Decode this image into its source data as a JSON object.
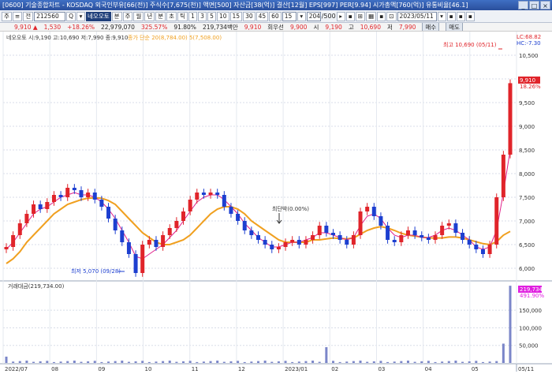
{
  "window": {
    "title": "[0600] 기술종합차트 - KOSDAQ 외국인부유[66(전)] 주식수[7,675(천)] 액면[500] 자산금[38(억)] 결산[12월] EPS[997] PER[9.94] 시가총액[760(억)] 유통비율[46.1]",
    "btn_min": "_",
    "btn_max": "□",
    "btn_close": "×"
  },
  "toolbar": {
    "item0": "주",
    "item1": "≡",
    "item2": "전",
    "code": "212560",
    "item4": "Q",
    "item5": "▾",
    "stock_name": "네오오토",
    "item7": "분",
    "item8": "주",
    "item9": "월",
    "item10": "년",
    "item11": "분",
    "item12": "초",
    "item13": "틱",
    "item14": "1",
    "item15": "3",
    "item16": "5",
    "item17": "10",
    "item18": "15",
    "item19": "30",
    "item20": "45",
    "item21": "60",
    "item22": "15",
    "item23": "▾",
    "count": "204",
    "count_total": "/500",
    "item26": "▸",
    "item27": "▪",
    "item28": "⊞",
    "item29": "▦",
    "item30": "▪",
    "item31": "⊡",
    "date": "2023/05/11",
    "item33": "▾",
    "item34": "▪",
    "item35": "▪",
    "item36": "▪"
  },
  "pricebar": {
    "price": "9,910 ▲",
    "change": "1,530",
    "change_pct": "+18.26%",
    "volume": "22,979,070",
    "volume_pct": "325.57%",
    "turnover": "91.80%",
    "amount": "219,734백만",
    "prev": "9,910",
    "bid": "9,900",
    "low_label": "시",
    "open": "9,190",
    "high_label": "고",
    "high": "10,690",
    "low2_label": "저",
    "low": "7,990",
    "sell_btn": "매수",
    "buy_btn": "매도",
    "label_rel": "회우선"
  },
  "legend": {
    "main": "네오오토 시:9,190 고:10,690 저:7,990 종:9,910",
    "ma": "종가 단순 20(8,784.00)  5(7,508.00)",
    "volume": "거래대금(219,734.00)",
    "lc": "LC:68.82",
    "hc": "HC:-7.30"
  },
  "annotations": {
    "max": "최고 10,690 (05/11)",
    "min": "최저 5,070 (09/28)",
    "mid": "최단박(0.00%)",
    "price_tag": "9,910",
    "price_tag_sub": "18.26%",
    "vol_tag": "219,734",
    "vol_tag_sub": "491.90%"
  },
  "colors": {
    "up": "#e0242a",
    "down": "#1d3fd0",
    "ma5": "#e0208a",
    "ma20": "#f0a020",
    "volume": "#7b86c9"
  },
  "chart_data": {
    "type": "line",
    "price_axis": {
      "ticks": [
        "10,500",
        "10,000",
        "9,500",
        "9,000",
        "8,500",
        "8,000",
        "7,500",
        "7,000",
        "6,500",
        "6,000"
      ]
    },
    "volume_axis": {
      "ticks": [
        "150,000",
        "100,000",
        "50,000"
      ]
    },
    "x_labels": [
      "2022/07",
      "08",
      "09",
      "10",
      "11",
      "12",
      "2023/01",
      "02",
      "03",
      "04",
      "05",
      "05/11"
    ],
    "series": [
      {
        "name": "종가",
        "values": [
          6450,
          6700,
          6950,
          7150,
          7350,
          7250,
          7400,
          7550,
          7500,
          7700,
          7650,
          7500,
          7600,
          7450,
          7300,
          7050,
          6800,
          6550,
          6300,
          5900,
          6500,
          6600,
          6450,
          6700,
          6850,
          7000,
          7200,
          7450,
          7600,
          7550,
          7600,
          7550,
          7300,
          7150,
          7000,
          6800,
          6700,
          6600,
          6500,
          6400,
          6450,
          6550,
          6600,
          6500,
          6600,
          6700,
          6900,
          6750,
          6700,
          6600,
          6500,
          6700,
          7200,
          7300,
          7100,
          6900,
          6600,
          6550,
          6700,
          6800,
          6700,
          6650,
          6600,
          6700,
          6900,
          6950,
          6750,
          6600,
          6500,
          6400,
          6300,
          6500,
          7500,
          8400,
          9910
        ]
      },
      {
        "name": "5",
        "values": [
          6400,
          6550,
          6750,
          6950,
          7150,
          7250,
          7300,
          7400,
          7500,
          7550,
          7600,
          7550,
          7550,
          7500,
          7400,
          7250,
          7050,
          6800,
          6550,
          6250,
          6200,
          6300,
          6400,
          6500,
          6650,
          6800,
          7000,
          7200,
          7400,
          7500,
          7550,
          7550,
          7450,
          7300,
          7150,
          6950,
          6800,
          6650,
          6550,
          6450,
          6450,
          6500,
          6550,
          6550,
          6600,
          6650,
          6750,
          6750,
          6700,
          6650,
          6600,
          6650,
          6900,
          7100,
          7150,
          7050,
          6850,
          6700,
          6650,
          6700,
          6700,
          6650,
          6650,
          6700,
          6800,
          6850,
          6800,
          6700,
          6600,
          6450,
          6400,
          6450,
          6800,
          7600,
          8500
        ]
      },
      {
        "name": "20",
        "values": [
          6100,
          6200,
          6350,
          6550,
          6700,
          6850,
          7000,
          7150,
          7250,
          7350,
          7400,
          7450,
          7480,
          7490,
          7480,
          7430,
          7350,
          7200,
          7050,
          6900,
          6750,
          6650,
          6550,
          6500,
          6500,
          6550,
          6600,
          6700,
          6850,
          7000,
          7150,
          7250,
          7300,
          7300,
          7250,
          7150,
          7000,
          6900,
          6800,
          6700,
          6600,
          6550,
          6550,
          6550,
          6550,
          6600,
          6600,
          6620,
          6640,
          6630,
          6620,
          6640,
          6720,
          6800,
          6850,
          6880,
          6850,
          6800,
          6740,
          6700,
          6680,
          6660,
          6640,
          6640,
          6640,
          6660,
          6660,
          6640,
          6600,
          6560,
          6520,
          6500,
          6560,
          6700,
          6780
        ]
      }
    ],
    "volume_spikes": [
      {
        "x": "2022/07",
        "value": 18000
      },
      {
        "x": "02",
        "value": 45000
      },
      {
        "x": "05/11",
        "value": 219734
      },
      {
        "x": "05/10",
        "value": 55000
      }
    ]
  }
}
